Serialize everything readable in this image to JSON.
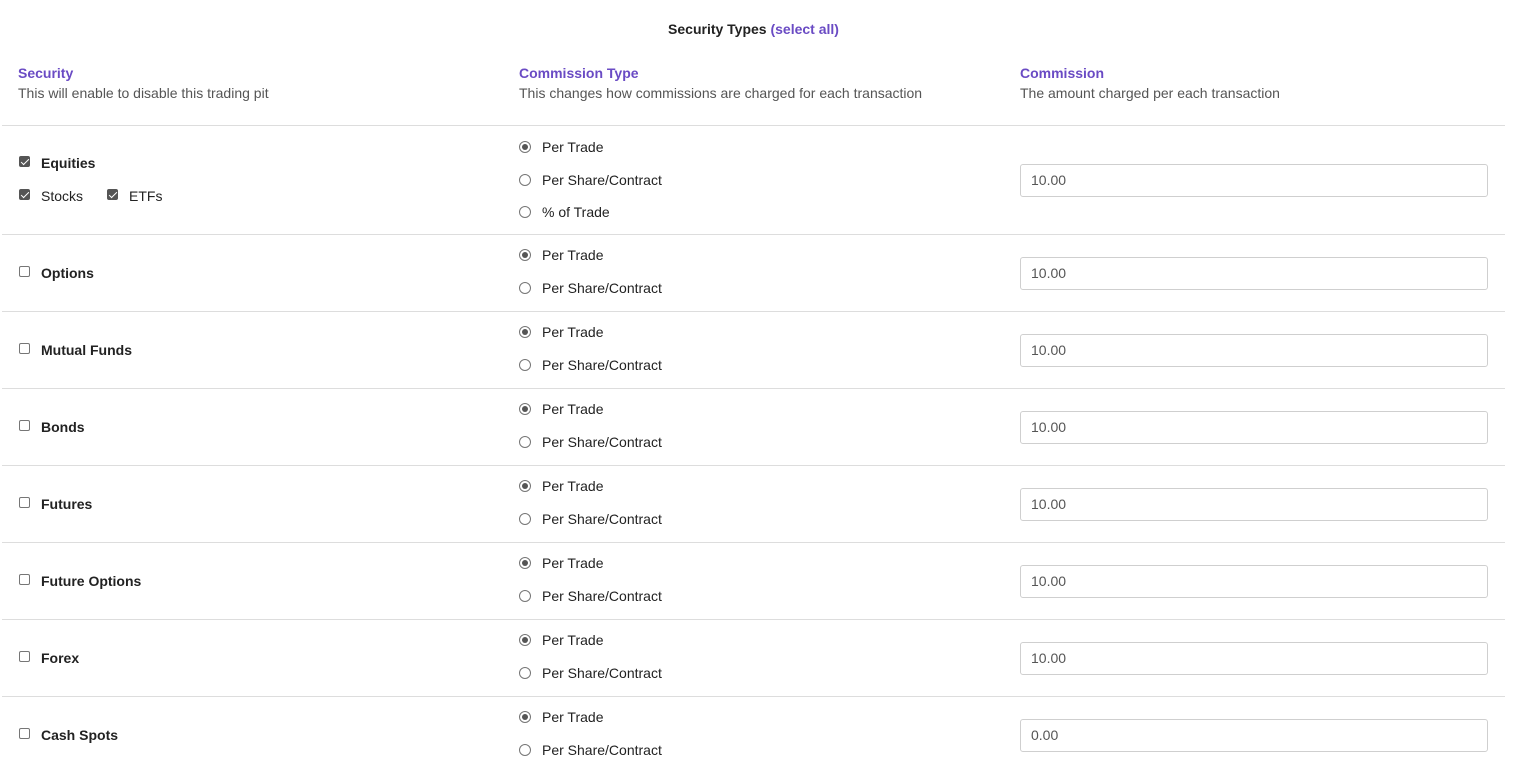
{
  "header": {
    "title": "Security Types",
    "select_all": "(select all)"
  },
  "columns": {
    "security": {
      "title": "Security",
      "desc": "This will enable to disable this trading pit"
    },
    "commission_type": {
      "title": "Commission Type",
      "desc": "This changes how commissions are charged for each transaction"
    },
    "commission": {
      "title": "Commission",
      "desc": "The amount charged per each transaction"
    }
  },
  "rows": [
    {
      "name": "Equities",
      "checked": true,
      "sub": [
        {
          "label": "Stocks",
          "checked": true
        },
        {
          "label": "ETFs",
          "checked": true
        }
      ],
      "options": [
        "Per Trade",
        "Per Share/Contract",
        "% of Trade"
      ],
      "selected": "Per Trade",
      "commission": "10.00"
    },
    {
      "name": "Options",
      "checked": false,
      "options": [
        "Per Trade",
        "Per Share/Contract"
      ],
      "selected": "Per Trade",
      "commission": "10.00"
    },
    {
      "name": "Mutual Funds",
      "checked": false,
      "options": [
        "Per Trade",
        "Per Share/Contract"
      ],
      "selected": "Per Trade",
      "commission": "10.00"
    },
    {
      "name": "Bonds",
      "checked": false,
      "options": [
        "Per Trade",
        "Per Share/Contract"
      ],
      "selected": "Per Trade",
      "commission": "10.00"
    },
    {
      "name": "Futures",
      "checked": false,
      "options": [
        "Per Trade",
        "Per Share/Contract"
      ],
      "selected": "Per Trade",
      "commission": "10.00"
    },
    {
      "name": "Future Options",
      "checked": false,
      "options": [
        "Per Trade",
        "Per Share/Contract"
      ],
      "selected": "Per Trade",
      "commission": "10.00"
    },
    {
      "name": "Forex",
      "checked": false,
      "options": [
        "Per Trade",
        "Per Share/Contract"
      ],
      "selected": "Per Trade",
      "commission": "10.00"
    },
    {
      "name": "Cash Spots",
      "checked": false,
      "options": [
        "Per Trade",
        "Per Share/Contract"
      ],
      "selected": "Per Trade",
      "commission": "0.00"
    }
  ],
  "colors": {
    "accent": "#6a4bc4",
    "divider": "#dddddd"
  }
}
